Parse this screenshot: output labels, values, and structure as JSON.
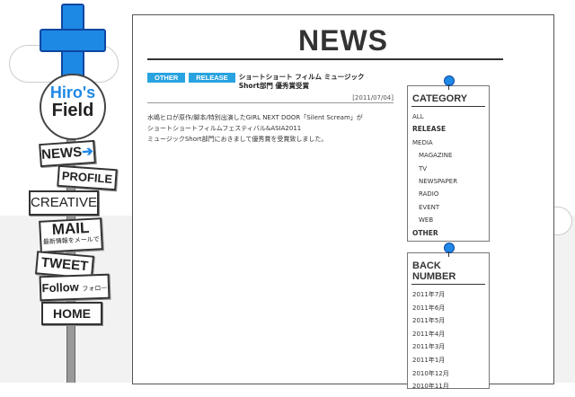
{
  "site": {
    "logo_line1": "Hiro's",
    "logo_line2": "Field"
  },
  "nav": {
    "news": "NEWS",
    "news_arrow": "➔",
    "profile": "PROFILE",
    "creative": "CREATIVE",
    "mail": "MAIL",
    "mail_sub": "最新情報をメールで",
    "tweet": "TWEET",
    "follow": "Follow",
    "follow_sub": "フォローする",
    "home": "HOME"
  },
  "page": {
    "title": "NEWS"
  },
  "article": {
    "tags": [
      "OTHER",
      "RELEASE"
    ],
    "title": "ショートショート フィルム ミュージックShort部門 優秀賞受賞",
    "date": "[2011/07/04]",
    "body": "水嶋ヒロが原作/脚本/特別出演したGIRL NEXT DOOR「Silent Scream」が\nショートショートフィルムフェスティバル&ASIA2011\nミュージックShort部門におきまして優秀賞を受賞致しました。"
  },
  "category": {
    "heading": "CATEGORY",
    "items": [
      {
        "label": "ALL"
      },
      {
        "label": "RELEASE"
      },
      {
        "label": "MEDIA"
      },
      {
        "label": "MAGAZINE"
      },
      {
        "label": "TV"
      },
      {
        "label": "NEWSPAPER"
      },
      {
        "label": "RADIO"
      },
      {
        "label": "EVENT"
      },
      {
        "label": "WEB"
      },
      {
        "label": "OTHER"
      }
    ]
  },
  "back_number": {
    "heading": "BACK NUMBER",
    "items": [
      "2011年7月",
      "2011年6月",
      "2011年5月",
      "2011年4月",
      "2011年3月",
      "2011年1月",
      "2010年12月",
      "2010年11月"
    ]
  },
  "colors": {
    "accent_blue": "#1e88e5",
    "tag_blue": "#29a3e0"
  }
}
